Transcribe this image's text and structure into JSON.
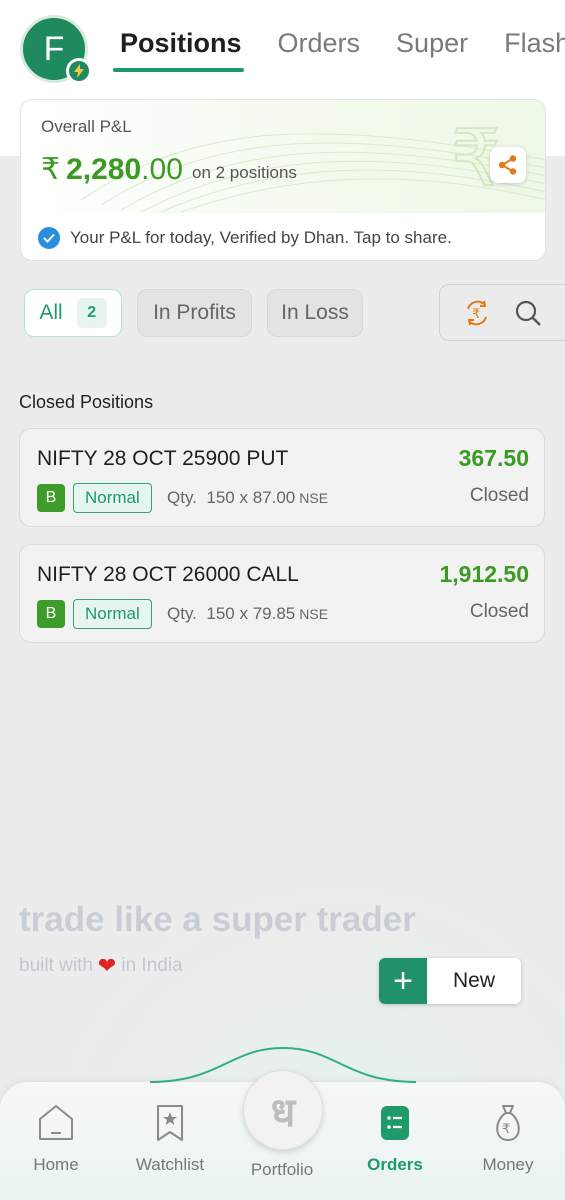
{
  "header": {
    "avatar_initial": "F",
    "tabs": [
      {
        "label": "Positions",
        "active": true
      },
      {
        "label": "Orders",
        "active": false
      },
      {
        "label": "Super",
        "active": false
      },
      {
        "label": "Flash",
        "active": false
      }
    ]
  },
  "pnl": {
    "title": "Overall P&L",
    "currency": "₹",
    "amount_int": "2,280",
    "amount_dec": ".00",
    "positions_text": "on 2 positions",
    "verified_text": "Your P&L for today, Verified by Dhan. Tap to share."
  },
  "filters": {
    "all_label": "All",
    "all_count": "2",
    "profits_label": "In Profits",
    "loss_label": "In Loss"
  },
  "section_label": "Closed Positions",
  "positions": [
    {
      "name": "NIFTY 28 OCT 25900 PUT",
      "pnl": "367.50",
      "side": "B",
      "type": "Normal",
      "qty_label": "Qty.",
      "qty": "150",
      "times": "x",
      "price": "87.00",
      "exchange": "NSE",
      "status": "Closed"
    },
    {
      "name": "NIFTY 28 OCT 26000 CALL",
      "pnl": "1,912.50",
      "side": "B",
      "type": "Normal",
      "qty_label": "Qty.",
      "qty": "150",
      "times": "x",
      "price": "79.85",
      "exchange": "NSE",
      "status": "Closed"
    }
  ],
  "brand": {
    "tagline": "trade like a super trader",
    "sub_before": "built with",
    "sub_after": "in India"
  },
  "new_button": {
    "label": "New"
  },
  "bottom_nav": {
    "home": "Home",
    "watchlist": "Watchlist",
    "portfolio": "Portfolio",
    "portfolio_glyph": "ध",
    "orders": "Orders",
    "money": "Money"
  },
  "colors": {
    "brand_green": "#1f9a6a",
    "profit_green": "#3a9a22",
    "verify_blue": "#2a8ee0",
    "heart_red": "#e02424"
  }
}
